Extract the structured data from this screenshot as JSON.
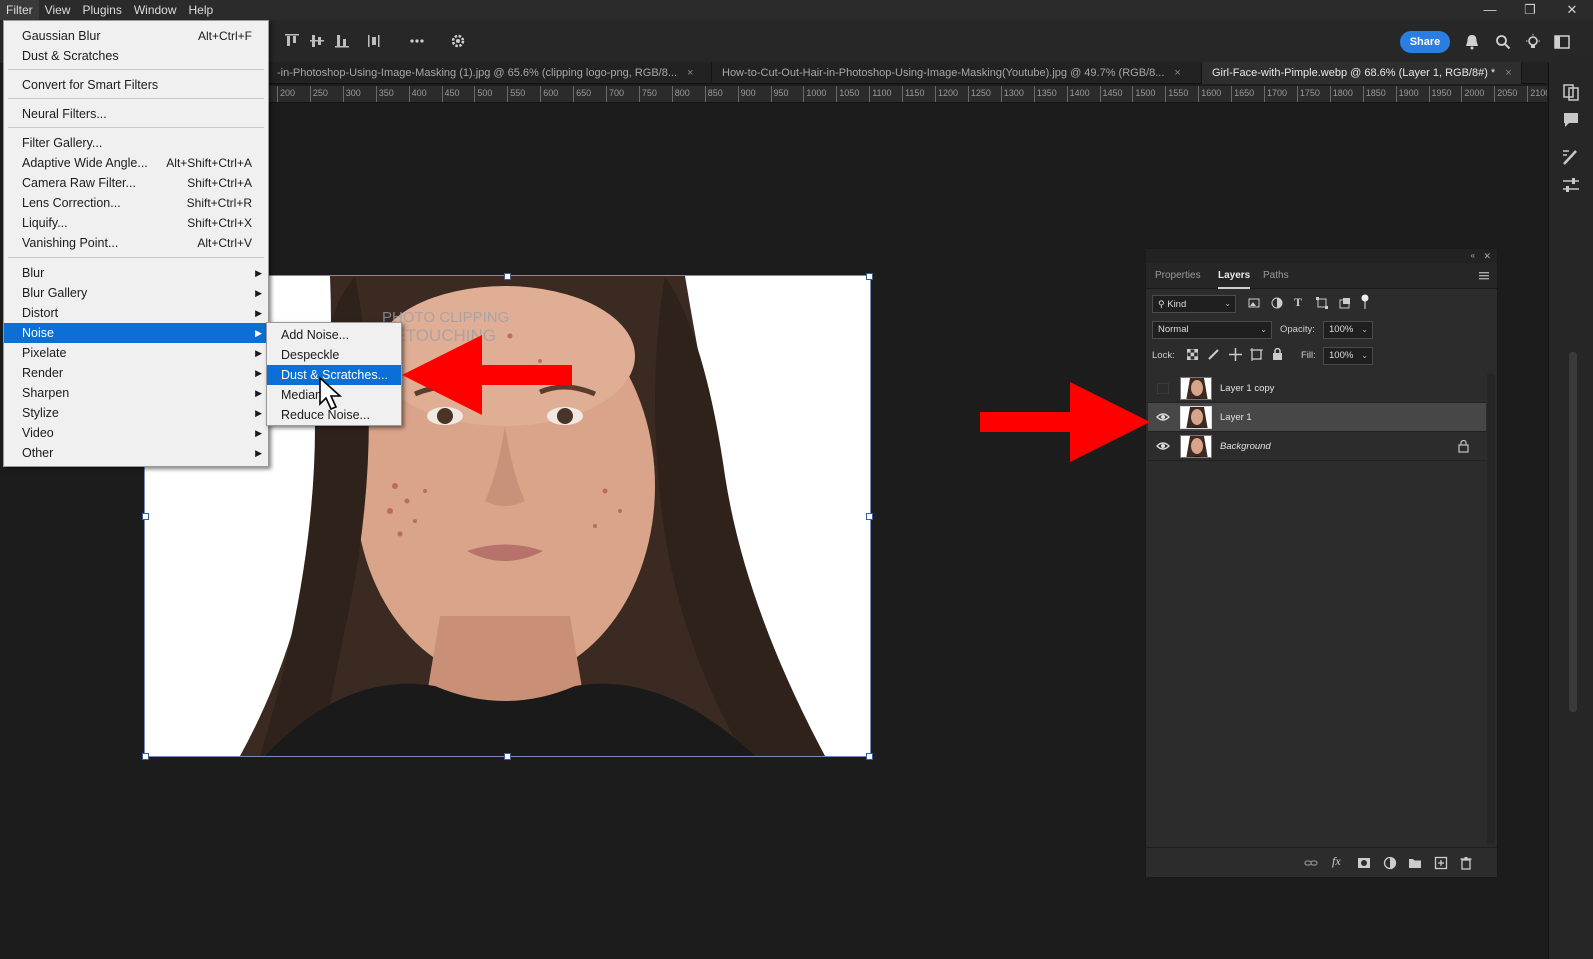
{
  "menubar": {
    "items": [
      "Filter",
      "View",
      "Plugins",
      "Window",
      "Help"
    ],
    "window_controls": {
      "minimize": "—",
      "restore": "❐",
      "close": "✕"
    }
  },
  "options_bar": {
    "share_label": "Share"
  },
  "tabs": [
    {
      "label": "-in-Photoshop-Using-Image-Masking (1).jpg @ 65.6% (clipping logo-png, RGB/8...",
      "close": "×"
    },
    {
      "label": "How-to-Cut-Out-Hair-in-Photoshop-Using-Image-Masking(Youtube).jpg @ 49.7% (RGB/8...",
      "close": "×"
    },
    {
      "label": "Girl-Face-with-Pimple.webp @ 68.6% (Layer 1, RGB/8#) *",
      "close": "×"
    }
  ],
  "ruler": {
    "ticks": [
      "200",
      "250",
      "300",
      "350",
      "400",
      "450",
      "500",
      "550",
      "600",
      "650",
      "700",
      "750",
      "800",
      "850",
      "900",
      "950",
      "1000",
      "1050",
      "1100",
      "1150",
      "1200",
      "1250",
      "1300",
      "1350",
      "1400",
      "1450",
      "1500",
      "1550",
      "1600",
      "1650",
      "1700",
      "1750",
      "1800",
      "1850",
      "1900",
      "1950",
      "2000",
      "2050",
      "2100"
    ]
  },
  "filter_menu": {
    "items": [
      {
        "label": "Gaussian Blur",
        "shortcut": "Alt+Ctrl+F"
      },
      {
        "label": "Dust & Scratches",
        "shortcut": ""
      },
      {
        "label": "Convert for Smart Filters",
        "shortcut": ""
      },
      {
        "label": "Neural Filters...",
        "shortcut": ""
      },
      {
        "label": "Filter Gallery...",
        "shortcut": ""
      },
      {
        "label": "Adaptive Wide Angle...",
        "shortcut": "Alt+Shift+Ctrl+A"
      },
      {
        "label": "Camera Raw Filter...",
        "shortcut": "Shift+Ctrl+A"
      },
      {
        "label": "Lens Correction...",
        "shortcut": "Shift+Ctrl+R"
      },
      {
        "label": "Liquify...",
        "shortcut": "Shift+Ctrl+X"
      },
      {
        "label": "Vanishing Point...",
        "shortcut": "Alt+Ctrl+V"
      },
      {
        "label": "Blur"
      },
      {
        "label": "Blur Gallery"
      },
      {
        "label": "Distort"
      },
      {
        "label": "Noise"
      },
      {
        "label": "Pixelate"
      },
      {
        "label": "Render"
      },
      {
        "label": "Sharpen"
      },
      {
        "label": "Stylize"
      },
      {
        "label": "Video"
      },
      {
        "label": "Other"
      }
    ],
    "highlighted": "Noise"
  },
  "noise_submenu": {
    "items": [
      "Add Noise...",
      "Despeckle",
      "Dust & Scratches...",
      "Median...",
      "Reduce Noise..."
    ],
    "highlighted": "Dust & Scratches..."
  },
  "watermark": {
    "line1": "PHOTO CLIPPING",
    "line2": "RETOUCHING"
  },
  "layers_panel": {
    "tabs": [
      "Properties",
      "Layers",
      "Paths"
    ],
    "active_tab": "Layers",
    "filter_kind": "Kind",
    "blend_mode": "Normal",
    "opacity_label": "Opacity:",
    "opacity_value": "100%",
    "lock_label": "Lock:",
    "fill_label": "Fill:",
    "fill_value": "100%",
    "layers": [
      {
        "name": "Layer 1 copy",
        "visible": false,
        "selected": false,
        "locked": false
      },
      {
        "name": "Layer 1",
        "visible": true,
        "selected": true,
        "locked": false
      },
      {
        "name": "Background",
        "visible": true,
        "selected": false,
        "locked": true
      }
    ]
  },
  "colors": {
    "accent_blue": "#0b6fd6",
    "share_blue": "#2a7de1",
    "annotation_red": "#ff0000"
  }
}
